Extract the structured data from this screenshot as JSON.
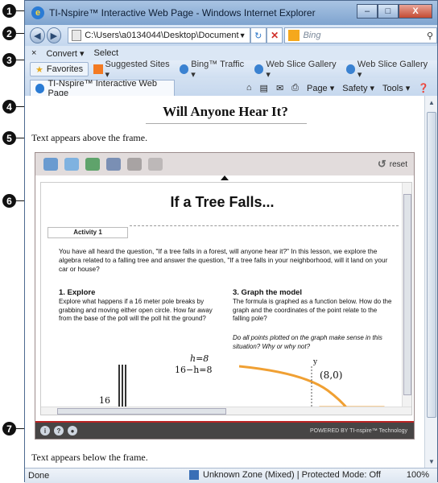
{
  "window": {
    "title": "TI-Nspire™ Interactive Web Page - Windows Internet Explorer",
    "minimize": "–",
    "maximize": "□",
    "close": "X"
  },
  "address_bar": {
    "url": "C:\\Users\\a0134044\\Desktop\\Document",
    "search_placeholder": "Bing"
  },
  "command_bar": {
    "close_x": "×",
    "convert": "Convert ▾",
    "select": "Select"
  },
  "favorites_bar": {
    "favorites": "Favorites",
    "items": [
      "Suggested Sites ▾",
      "Bing™ Traffic ▾",
      "Web Slice Gallery ▾",
      "Web Slice Gallery ▾"
    ]
  },
  "tab": {
    "label": "TI-Nspire™ Interactive Web Page"
  },
  "tab_tools": [
    "Page ▾",
    "Safety ▾",
    "Tools ▾"
  ],
  "page": {
    "heading": "Will Anyone Hear It?",
    "text_above": "Text appears above the frame.",
    "text_below": "Text appears below the frame."
  },
  "frame": {
    "reset_label": "reset",
    "lesson_title": "If a Tree Falls...",
    "activity_tab": "Activity 1",
    "intro": "You have all heard the question, \"If a tree falls in a forest, will anyone hear it?\" In this lesson, we explore the algebra related to a falling tree and answer the question, \"If a tree falls in your neighborhood, will it land on your car or house?",
    "col1_heading": "1. Explore",
    "col1_text": "Explore what happens if a 16 meter pole breaks by grabbing and moving either open circle. How far away from the base of the poll will the poll hit the ground?",
    "col2_heading": "3. Graph the model",
    "col2_text": "The formula is graphed as a function below. How do the graph and the coordinates of the point relate to the falling pole?",
    "col2_question": "Do all points plotted on the graph make sense in this situation? Why or why not?",
    "math_h": "h=8",
    "math_eq": "16−h=8",
    "math_16": "16",
    "point_label": "(8,0)",
    "axis_y": "y",
    "powered_by": "POWERED BY TI-nspire™ Technology"
  },
  "status_bar": {
    "status": "Done",
    "zone": "Unknown Zone (Mixed) | Protected Mode: Off",
    "zoom": "100%"
  },
  "callouts": [
    "1",
    "2",
    "3",
    "4",
    "5",
    "6",
    "7"
  ]
}
